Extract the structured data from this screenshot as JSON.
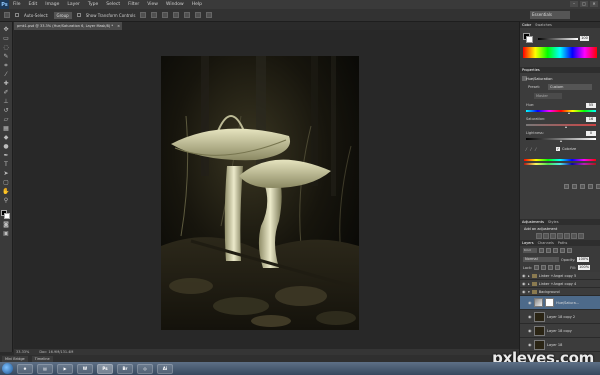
{
  "app": {
    "logo": "Ps"
  },
  "menu": [
    "File",
    "Edit",
    "Image",
    "Layer",
    "Type",
    "Select",
    "Filter",
    "View",
    "Window",
    "Help"
  ],
  "window_controls": [
    "–",
    "□",
    "✕"
  ],
  "options_bar": {
    "auto_select_label": "Auto-Select:",
    "auto_select_value": "Group",
    "show_transform_label": "Show Transform Controls",
    "workspace": "Essentials"
  },
  "document": {
    "tab_title": "pmk1.psd @ 33.3% (Hue/Saturation 6, Layer Mask/8) *",
    "tab_close": "×",
    "zoom": "33.33%",
    "doc_info": "Doc: 16.9M/131.4M"
  },
  "mini_bridge": {
    "tabs": [
      "Mini Bridge",
      "Timeline"
    ]
  },
  "panels": {
    "color": {
      "tabs": [
        "Color",
        "Swatches"
      ],
      "k_value": "100"
    },
    "properties": {
      "tab": "Properties",
      "title": "Hue/Saturation",
      "preset_label": "Preset:",
      "preset_value": "Custom",
      "channel_value": "Master",
      "hue_label": "Hue:",
      "hue_value": "55",
      "saturation_label": "Saturation:",
      "saturation_value": "16",
      "lightness_label": "Lightness:",
      "lightness_value": "0",
      "colorize_label": "Colorize"
    },
    "adjustments": {
      "tabs": [
        "Adjustments",
        "Styles"
      ],
      "title": "Add an adjustment"
    },
    "layers": {
      "tabs": [
        "Layers",
        "Channels",
        "Paths"
      ],
      "kind_label": "Kind",
      "blend_mode": "Normal",
      "opacity_label": "Opacity:",
      "opacity_value": "100%",
      "lock_label": "Lock:",
      "fill_label": "Fill:",
      "fill_value": "100%",
      "items": [
        {
          "name": "Linker +Angel copy 5",
          "type": "group"
        },
        {
          "name": "Linker +Angel copy 4",
          "type": "group"
        },
        {
          "name": "Background",
          "type": "group"
        },
        {
          "name": "Hue/Satura...",
          "type": "adjustment",
          "selected": true
        },
        {
          "name": "Layer 18 copy 2",
          "type": "pixel"
        },
        {
          "name": "Layer 18 copy",
          "type": "pixel"
        },
        {
          "name": "Layer 18",
          "type": "pixel"
        }
      ]
    }
  },
  "taskbar": {
    "apps": [
      "e",
      "▤",
      "▶",
      "W",
      "Ps",
      "Br",
      "◎",
      "Ai"
    ]
  },
  "watermark": "pxleyes.com"
}
